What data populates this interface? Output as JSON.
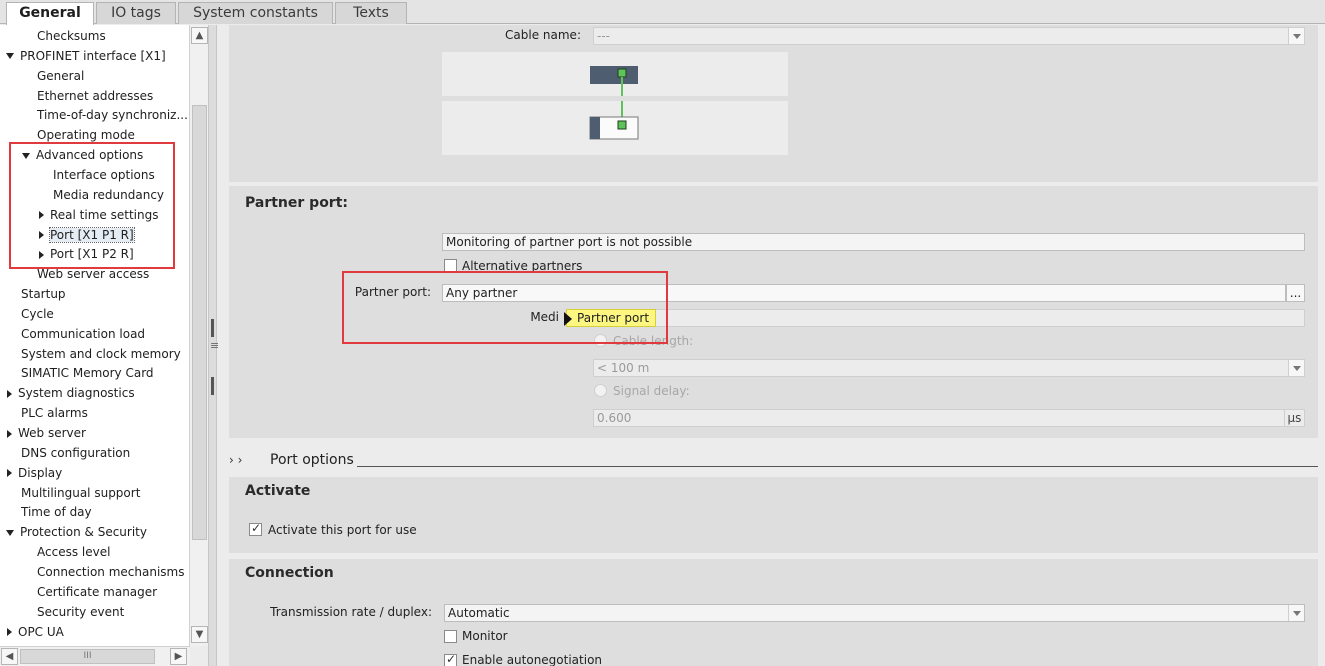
{
  "tabs": [
    {
      "label": "General",
      "active": true
    },
    {
      "label": "IO tags",
      "active": false
    },
    {
      "label": "System constants",
      "active": false
    },
    {
      "label": "Texts",
      "active": false
    }
  ],
  "tree": [
    {
      "label": "Checksums",
      "indent": 1,
      "expander": "none"
    },
    {
      "label": "PROFINET interface [X1]",
      "indent": 0,
      "expander": "down"
    },
    {
      "label": "General",
      "indent": 1,
      "expander": "none"
    },
    {
      "label": "Ethernet addresses",
      "indent": 1,
      "expander": "none"
    },
    {
      "label": "Time-of-day synchroniz...",
      "indent": 1,
      "expander": "none"
    },
    {
      "label": "Operating mode",
      "indent": 1,
      "expander": "none"
    },
    {
      "label": "Advanced options",
      "indent": 1,
      "expander": "down"
    },
    {
      "label": "Interface options",
      "indent": 2,
      "expander": "none"
    },
    {
      "label": "Media redundancy",
      "indent": 2,
      "expander": "none"
    },
    {
      "label": "Real time settings",
      "indent": 2,
      "expander": "right"
    },
    {
      "label": "Port [X1 P1 R]",
      "indent": 2,
      "expander": "right",
      "selected": true
    },
    {
      "label": "Port [X1 P2 R]",
      "indent": 2,
      "expander": "right"
    },
    {
      "label": "Web server access",
      "indent": 1,
      "expander": "none"
    },
    {
      "label": "Startup",
      "indent": 0,
      "expander": "none"
    },
    {
      "label": "Cycle",
      "indent": 0,
      "expander": "none"
    },
    {
      "label": "Communication load",
      "indent": 0,
      "expander": "none"
    },
    {
      "label": "System and clock memory",
      "indent": 0,
      "expander": "none"
    },
    {
      "label": "SIMATIC Memory Card",
      "indent": 0,
      "expander": "none"
    },
    {
      "label": "System diagnostics",
      "indent": 0,
      "expander": "right"
    },
    {
      "label": "PLC alarms",
      "indent": 0,
      "expander": "none"
    },
    {
      "label": "Web server",
      "indent": 0,
      "expander": "right"
    },
    {
      "label": "DNS configuration",
      "indent": 0,
      "expander": "none"
    },
    {
      "label": "Display",
      "indent": 0,
      "expander": "right"
    },
    {
      "label": "Multilingual support",
      "indent": 0,
      "expander": "none"
    },
    {
      "label": "Time of day",
      "indent": 0,
      "expander": "none"
    },
    {
      "label": "Protection & Security",
      "indent": 0,
      "expander": "down"
    },
    {
      "label": "Access level",
      "indent": 1,
      "expander": "none"
    },
    {
      "label": "Connection mechanisms",
      "indent": 1,
      "expander": "none"
    },
    {
      "label": "Certificate manager",
      "indent": 1,
      "expander": "none"
    },
    {
      "label": "Security event",
      "indent": 1,
      "expander": "none"
    },
    {
      "label": "OPC UA",
      "indent": 0,
      "expander": "right"
    }
  ],
  "top_section": {
    "cable_name_label": "Cable name:",
    "cable_name_value": "---"
  },
  "partner": {
    "title": "Partner port:",
    "monitoring_text": "Monitoring of partner port is not possible",
    "alternative_partners_label": "Alternative partners",
    "partner_port_label": "Partner port:",
    "partner_port_value": "Any partner",
    "browse_label": "...",
    "medium_label_partial": "Medi",
    "tooltip": "Partner port",
    "cable_length_label": "Cable length:",
    "cable_length_value": "< 100 m",
    "signal_delay_label": "Signal delay:",
    "signal_delay_value": "0.600",
    "signal_delay_unit": "µs"
  },
  "port_options": {
    "label": "Port options",
    "chevrons": "› ›"
  },
  "activate": {
    "title": "Activate",
    "checkbox_label": "Activate this port for use"
  },
  "connection": {
    "title": "Connection",
    "rate_label": "Transmission rate / duplex:",
    "rate_value": "Automatic",
    "monitor_label": "Monitor",
    "autoneg_label": "Enable autonegotiation"
  },
  "scroll": {
    "up": "▲",
    "down": "▼",
    "left": "◀",
    "right": "▶",
    "hgrip": "III",
    "vgrip": "≡"
  },
  "colors": {
    "highlight_box": "#e0393e",
    "tooltip_bg": "#fdf782",
    "device_accent": "#5fc25a"
  }
}
